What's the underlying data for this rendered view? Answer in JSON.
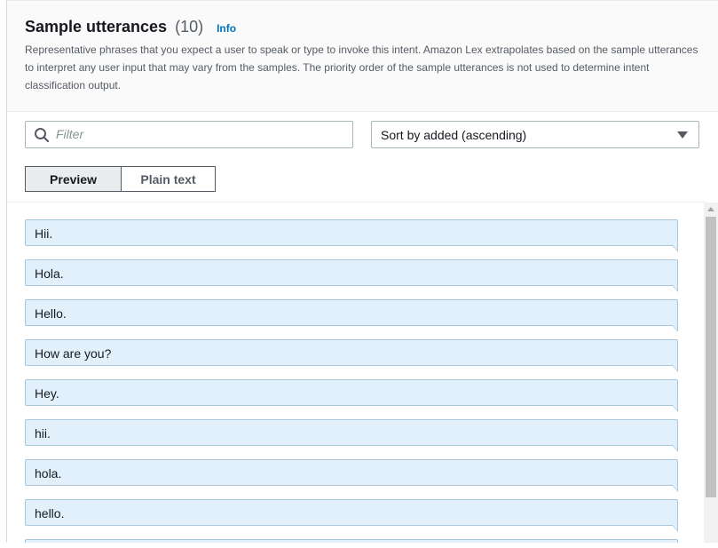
{
  "section": {
    "title": "Sample utterances",
    "count": "(10)",
    "info_link": "Info",
    "description": "Representative phrases that you expect a user to speak or type to invoke this intent. Amazon Lex extrapolates based on the sample utterances to interpret any user input that may vary from the samples. The priority order of the sample utterances is not used to determine intent classification output."
  },
  "filter": {
    "placeholder": "Filter",
    "value": ""
  },
  "sort": {
    "selected": "Sort by added (ascending)"
  },
  "view_toggle": {
    "preview_label": "Preview",
    "plain_text_label": "Plain text",
    "selected": "Preview"
  },
  "utterances": [
    "Hii.",
    "Hola.",
    "Hello.",
    "How are you?",
    "Hey.",
    "hii.",
    "hola.",
    "hello."
  ],
  "colors": {
    "info_link": "#0073bb",
    "utterance_bg": "#e1f0fb",
    "utterance_border": "#a9c7dc"
  }
}
